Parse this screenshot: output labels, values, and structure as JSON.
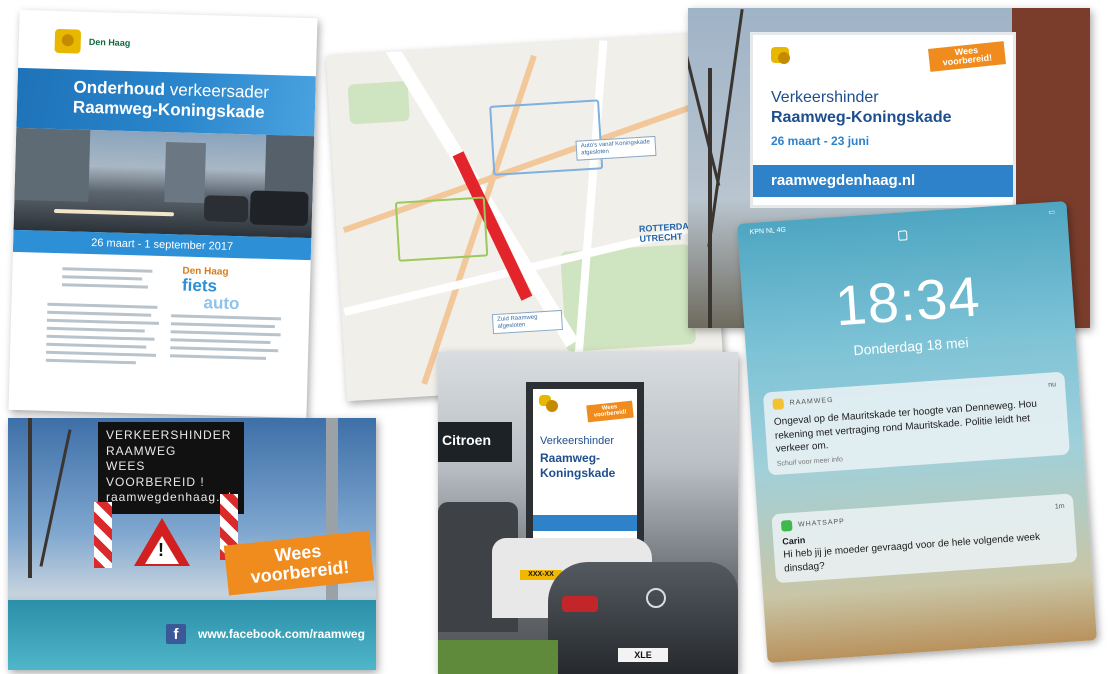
{
  "flyer": {
    "city": "Den Haag",
    "title_light": "Onderhoud",
    "title_rest": " verkeersader",
    "subtitle": "Raamweg-Koningskade",
    "dates": "26 maart - 1 september 2017",
    "brand_top": "Den Haag",
    "brand_mid": "fiets",
    "brand_bottom": "auto"
  },
  "map": {
    "callout_1": "Auto's vanaf Koningskade afgesloten",
    "callout_2": "Zuid Raamweg afgesloten",
    "destination_1": "ROTTERDAM",
    "destination_2": "UTRECHT"
  },
  "billboard": {
    "prepare_tag": "Wees voorbereid!",
    "line1": "Verkeershinder",
    "line2": "Raamweg-Koningskade",
    "dates": "26 maart - 23 juni",
    "url": "raamwegdenhaag.nl"
  },
  "phone": {
    "carrier": "KPN NL 4G",
    "time": "18:34",
    "date": "Donderdag 18 mei",
    "notification_1": {
      "app": "RAAMWEG",
      "when": "nu",
      "message": "Ongeval op de Mauritskade ter hoogte van Denneweg. Hou rekening met vertraging rond Mauritskade. Politie leidt het verkeer om.",
      "hint": "Schuif voor meer info"
    },
    "notification_2": {
      "app": "WHATSAPP",
      "when": "1m",
      "sender": "Carin",
      "message": "Hi heb jij je moeder gevraagd voor de hele volgende week dinsdag?"
    },
    "colors": {
      "raamweg_icon": "#f1c232",
      "whatsapp_icon": "#3fb94b"
    }
  },
  "street": {
    "panel_lines": [
      "VERKEERSHINDER",
      "RAAMWEG",
      "WEES VOORBEREID !",
      "raamwegdenhaag.nl"
    ],
    "prepare_tag": "Wees voorbereid!",
    "facebook_icon": "f",
    "facebook_url": "www.facebook.com/raamweg"
  },
  "cars": {
    "citroen": "Citroen",
    "poster_line1": "Verkeershinder",
    "poster_line2": "Raamweg-Koningskade",
    "poster_tag": "Wees voorbereid!",
    "plate": "XLE",
    "plate2": "XXX-XX"
  },
  "accent_colors": {
    "blue": "#2d82c9",
    "orange": "#f08b1e",
    "red": "#e3242b"
  }
}
